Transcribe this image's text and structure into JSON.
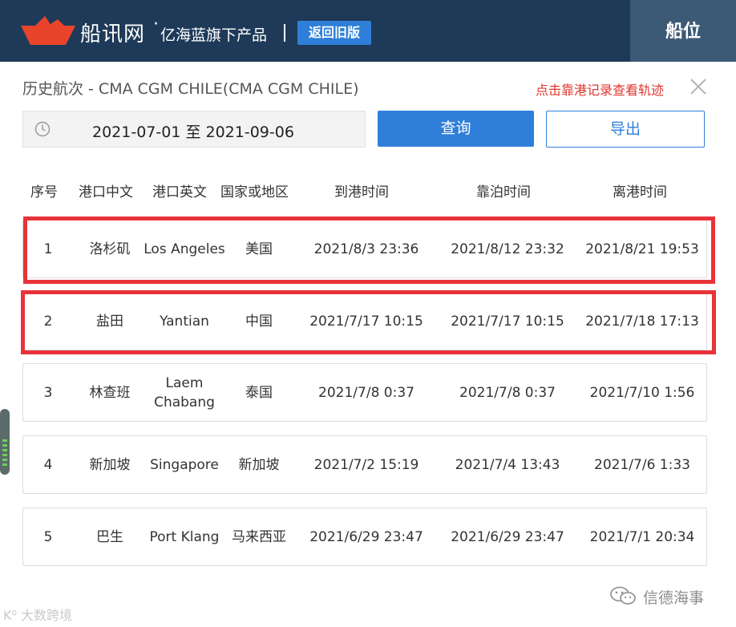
{
  "header": {
    "brand": "船讯网",
    "dot": "·",
    "tagline": "亿海蓝旗下产品",
    "separator": "|",
    "old_version_button": "返回旧版",
    "tab_label": "船位",
    "colors": {
      "bar": "#1e3a58",
      "accent": "#2f7fd8",
      "logo": "#e8442c"
    }
  },
  "page": {
    "title": "历史航次 - CMA CGM CHILE(CMA CGM CHILE)",
    "track_hint": "点击靠港记录查看轨迹",
    "close_icon": "close-icon"
  },
  "search": {
    "date_range": "2021-07-01 至 2021-09-06",
    "clock_icon": "clock-icon",
    "query_button": "查询",
    "export_button": "导出"
  },
  "table": {
    "headers": [
      "序号",
      "港口中文",
      "港口英文",
      "国家或地区",
      "到港时间",
      "靠泊时间",
      "离港时间"
    ],
    "rows": [
      {
        "no": "1",
        "port_cn": "洛杉矶",
        "port_en": "Los Angeles",
        "country": "美国",
        "arrival": "2021/8/3 23:36",
        "berth": "2021/8/12 23:32",
        "departure": "2021/8/21 19:53",
        "highlighted": true
      },
      {
        "no": "2",
        "port_cn": "盐田",
        "port_en": "Yantian",
        "country": "中国",
        "arrival": "2021/7/17 10:15",
        "berth": "2021/7/17 10:15",
        "departure": "2021/7/18 17:13",
        "highlighted": true
      },
      {
        "no": "3",
        "port_cn": "林查班",
        "port_en": "Laem Chabang",
        "country": "泰国",
        "arrival": "2021/7/8 0:37",
        "berth": "2021/7/8 0:37",
        "departure": "2021/7/10 1:56",
        "highlighted": false
      },
      {
        "no": "4",
        "port_cn": "新加坡",
        "port_en": "Singapore",
        "country": "新加坡",
        "arrival": "2021/7/2 15:19",
        "berth": "2021/7/4 13:43",
        "departure": "2021/7/6 1:33",
        "highlighted": false
      },
      {
        "no": "5",
        "port_cn": "巴生",
        "port_en": "Port Klang",
        "country": "马来西亚",
        "arrival": "2021/6/29 23:47",
        "berth": "2021/6/29 23:47",
        "departure": "2021/7/1 20:34",
        "highlighted": false
      }
    ],
    "highlight_color": "#e8333a"
  },
  "watermarks": {
    "left": "K⁰ 大数跨境",
    "right": "信德海事"
  }
}
